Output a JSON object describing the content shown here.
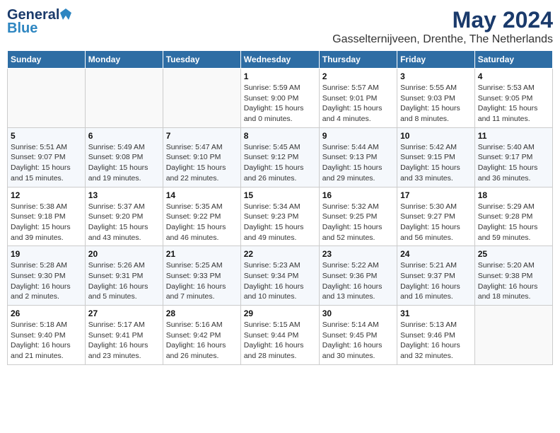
{
  "logo": {
    "general": "General",
    "blue": "Blue"
  },
  "title": "May 2024",
  "location": "Gasselternijveen, Drenthe, The Netherlands",
  "days_of_week": [
    "Sunday",
    "Monday",
    "Tuesday",
    "Wednesday",
    "Thursday",
    "Friday",
    "Saturday"
  ],
  "weeks": [
    [
      {
        "day": "",
        "detail": ""
      },
      {
        "day": "",
        "detail": ""
      },
      {
        "day": "",
        "detail": ""
      },
      {
        "day": "1",
        "detail": "Sunrise: 5:59 AM\nSunset: 9:00 PM\nDaylight: 15 hours\nand 0 minutes."
      },
      {
        "day": "2",
        "detail": "Sunrise: 5:57 AM\nSunset: 9:01 PM\nDaylight: 15 hours\nand 4 minutes."
      },
      {
        "day": "3",
        "detail": "Sunrise: 5:55 AM\nSunset: 9:03 PM\nDaylight: 15 hours\nand 8 minutes."
      },
      {
        "day": "4",
        "detail": "Sunrise: 5:53 AM\nSunset: 9:05 PM\nDaylight: 15 hours\nand 11 minutes."
      }
    ],
    [
      {
        "day": "5",
        "detail": "Sunrise: 5:51 AM\nSunset: 9:07 PM\nDaylight: 15 hours\nand 15 minutes."
      },
      {
        "day": "6",
        "detail": "Sunrise: 5:49 AM\nSunset: 9:08 PM\nDaylight: 15 hours\nand 19 minutes."
      },
      {
        "day": "7",
        "detail": "Sunrise: 5:47 AM\nSunset: 9:10 PM\nDaylight: 15 hours\nand 22 minutes."
      },
      {
        "day": "8",
        "detail": "Sunrise: 5:45 AM\nSunset: 9:12 PM\nDaylight: 15 hours\nand 26 minutes."
      },
      {
        "day": "9",
        "detail": "Sunrise: 5:44 AM\nSunset: 9:13 PM\nDaylight: 15 hours\nand 29 minutes."
      },
      {
        "day": "10",
        "detail": "Sunrise: 5:42 AM\nSunset: 9:15 PM\nDaylight: 15 hours\nand 33 minutes."
      },
      {
        "day": "11",
        "detail": "Sunrise: 5:40 AM\nSunset: 9:17 PM\nDaylight: 15 hours\nand 36 minutes."
      }
    ],
    [
      {
        "day": "12",
        "detail": "Sunrise: 5:38 AM\nSunset: 9:18 PM\nDaylight: 15 hours\nand 39 minutes."
      },
      {
        "day": "13",
        "detail": "Sunrise: 5:37 AM\nSunset: 9:20 PM\nDaylight: 15 hours\nand 43 minutes."
      },
      {
        "day": "14",
        "detail": "Sunrise: 5:35 AM\nSunset: 9:22 PM\nDaylight: 15 hours\nand 46 minutes."
      },
      {
        "day": "15",
        "detail": "Sunrise: 5:34 AM\nSunset: 9:23 PM\nDaylight: 15 hours\nand 49 minutes."
      },
      {
        "day": "16",
        "detail": "Sunrise: 5:32 AM\nSunset: 9:25 PM\nDaylight: 15 hours\nand 52 minutes."
      },
      {
        "day": "17",
        "detail": "Sunrise: 5:30 AM\nSunset: 9:27 PM\nDaylight: 15 hours\nand 56 minutes."
      },
      {
        "day": "18",
        "detail": "Sunrise: 5:29 AM\nSunset: 9:28 PM\nDaylight: 15 hours\nand 59 minutes."
      }
    ],
    [
      {
        "day": "19",
        "detail": "Sunrise: 5:28 AM\nSunset: 9:30 PM\nDaylight: 16 hours\nand 2 minutes."
      },
      {
        "day": "20",
        "detail": "Sunrise: 5:26 AM\nSunset: 9:31 PM\nDaylight: 16 hours\nand 5 minutes."
      },
      {
        "day": "21",
        "detail": "Sunrise: 5:25 AM\nSunset: 9:33 PM\nDaylight: 16 hours\nand 7 minutes."
      },
      {
        "day": "22",
        "detail": "Sunrise: 5:23 AM\nSunset: 9:34 PM\nDaylight: 16 hours\nand 10 minutes."
      },
      {
        "day": "23",
        "detail": "Sunrise: 5:22 AM\nSunset: 9:36 PM\nDaylight: 16 hours\nand 13 minutes."
      },
      {
        "day": "24",
        "detail": "Sunrise: 5:21 AM\nSunset: 9:37 PM\nDaylight: 16 hours\nand 16 minutes."
      },
      {
        "day": "25",
        "detail": "Sunrise: 5:20 AM\nSunset: 9:38 PM\nDaylight: 16 hours\nand 18 minutes."
      }
    ],
    [
      {
        "day": "26",
        "detail": "Sunrise: 5:18 AM\nSunset: 9:40 PM\nDaylight: 16 hours\nand 21 minutes."
      },
      {
        "day": "27",
        "detail": "Sunrise: 5:17 AM\nSunset: 9:41 PM\nDaylight: 16 hours\nand 23 minutes."
      },
      {
        "day": "28",
        "detail": "Sunrise: 5:16 AM\nSunset: 9:42 PM\nDaylight: 16 hours\nand 26 minutes."
      },
      {
        "day": "29",
        "detail": "Sunrise: 5:15 AM\nSunset: 9:44 PM\nDaylight: 16 hours\nand 28 minutes."
      },
      {
        "day": "30",
        "detail": "Sunrise: 5:14 AM\nSunset: 9:45 PM\nDaylight: 16 hours\nand 30 minutes."
      },
      {
        "day": "31",
        "detail": "Sunrise: 5:13 AM\nSunset: 9:46 PM\nDaylight: 16 hours\nand 32 minutes."
      },
      {
        "day": "",
        "detail": ""
      }
    ]
  ]
}
